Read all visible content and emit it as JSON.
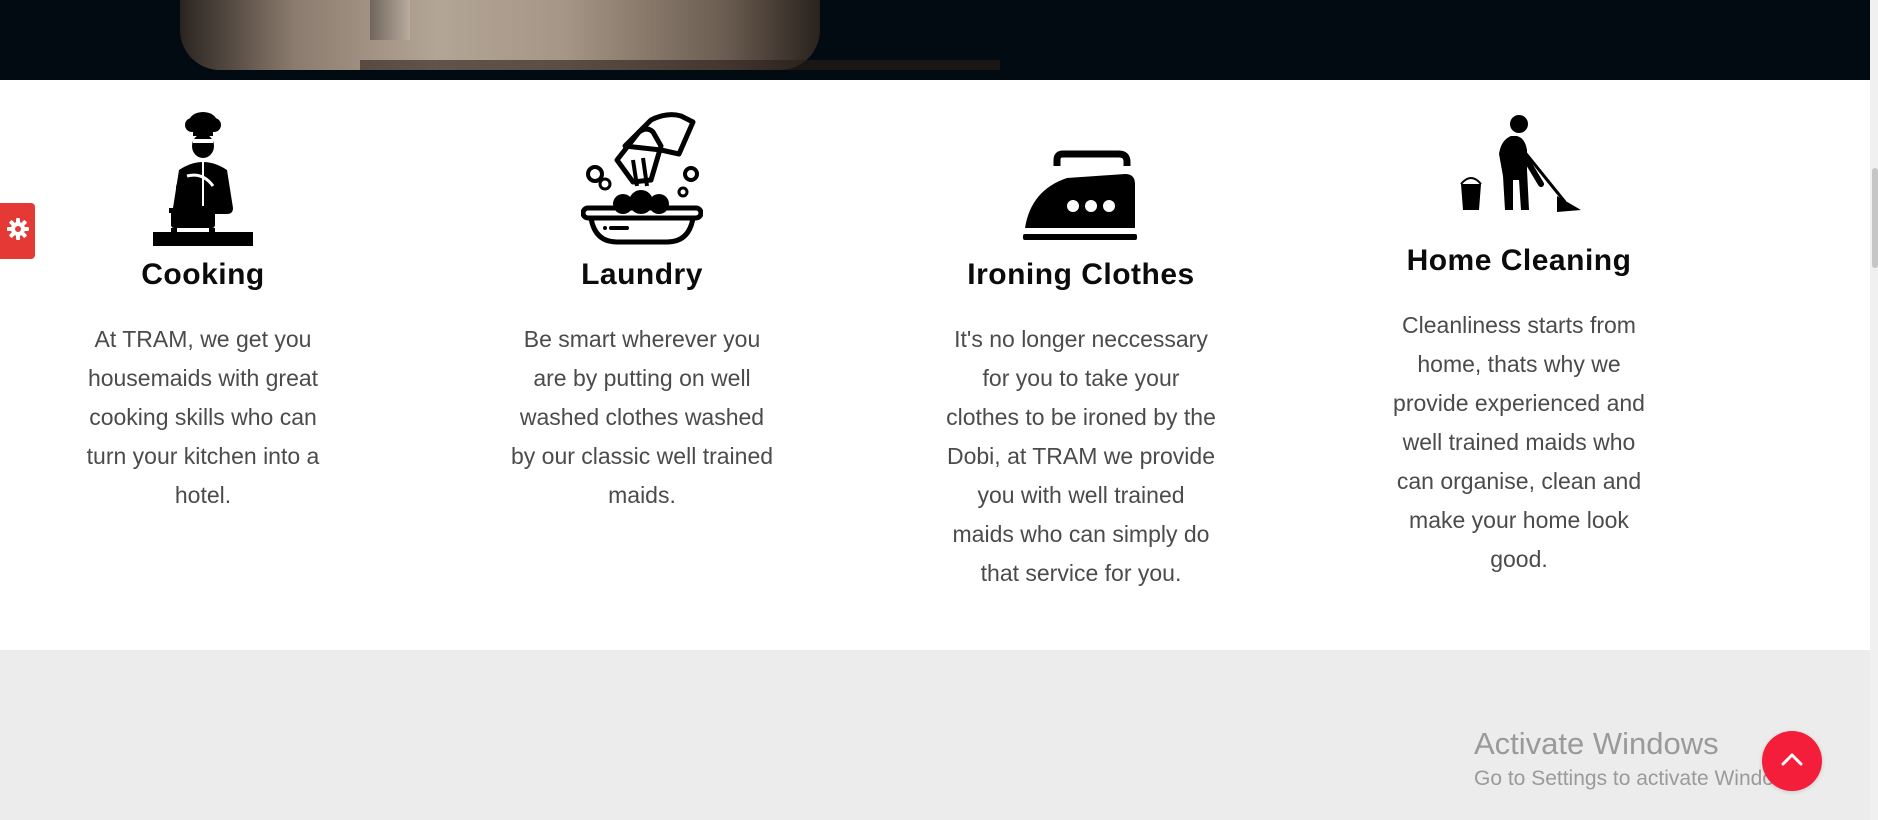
{
  "services": [
    {
      "icon": "chef-cooking-icon",
      "title": "Cooking",
      "description": "At TRAM, we get you housemaids with great cooking skills who can turn your kitchen into a hotel."
    },
    {
      "icon": "laundry-washing-icon",
      "title": "Laundry",
      "description": "Be smart wherever you are by putting on well washed clothes washed by our classic well trained maids."
    },
    {
      "icon": "clothes-iron-icon",
      "title": "Ironing Clothes",
      "description": "It's no longer neccessary for you to take your clothes to be ironed by the Dobi, at TRAM we provide you with well trained maids who can simply do that service for you."
    },
    {
      "icon": "person-sweeping-icon",
      "title": "Home Cleaning",
      "description": "Cleanliness starts from home, thats why we provide experienced and well trained maids who can organise, clean and make your home look good."
    }
  ],
  "windows_watermark": {
    "title": "Activate Windows",
    "subtitle": "Go to Settings to activate Windows."
  },
  "colors": {
    "accent_red": "#f41e3a",
    "settings_red": "#e53935",
    "footer_grey": "#ececec",
    "text_grey": "#4b4b4b"
  }
}
